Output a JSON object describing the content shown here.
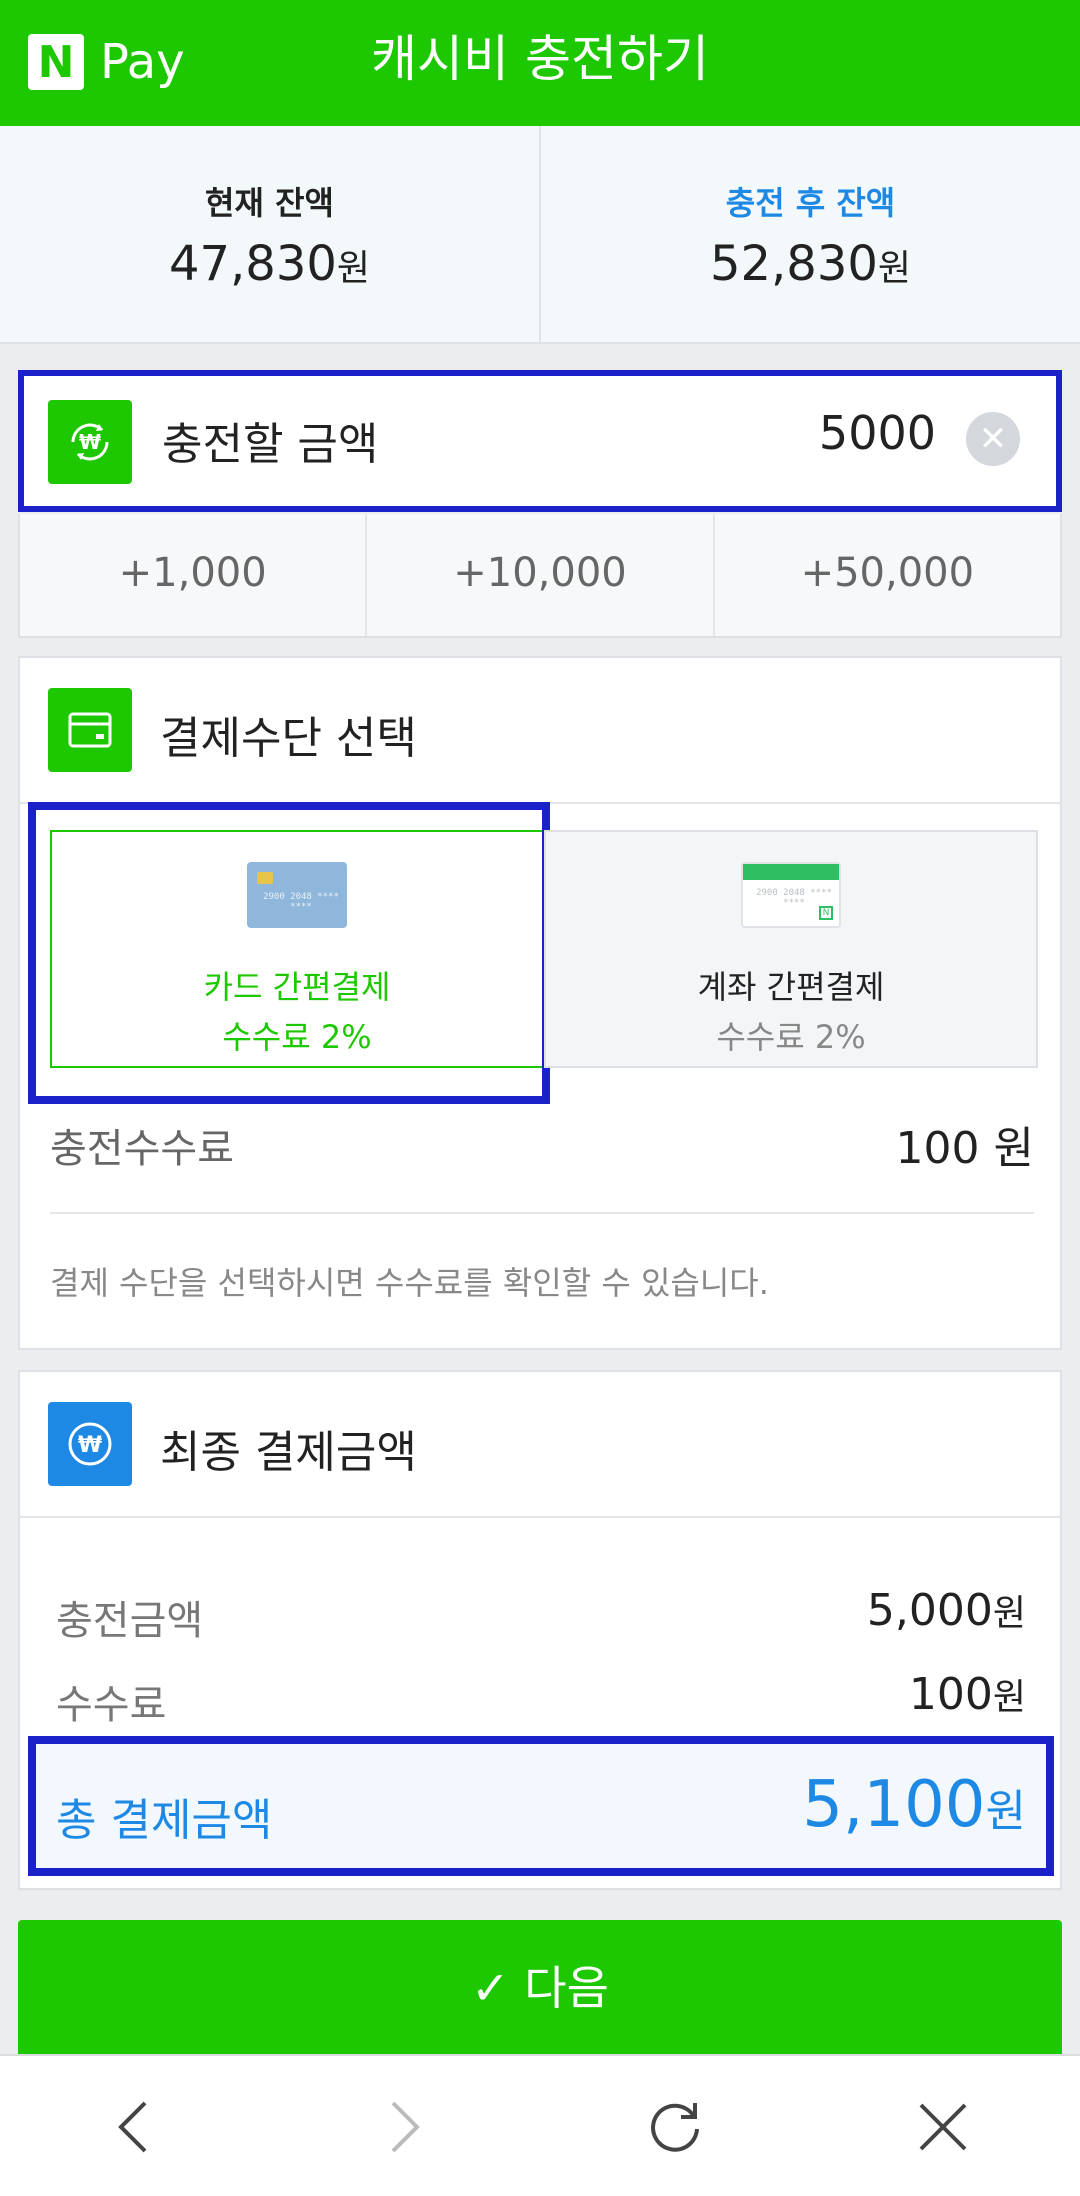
{
  "header": {
    "logo_n": "N",
    "logo_text": "Pay",
    "title": "캐시비 충전하기"
  },
  "balance": {
    "current_label": "현재 잔액",
    "current_value": "47,830",
    "after_label": "충전 후 잔액",
    "after_value": "52,830",
    "unit": "원"
  },
  "charge": {
    "label": "충전할 금액",
    "value": "5000",
    "quick_buttons": [
      "+1,000",
      "+10,000",
      "+50,000"
    ]
  },
  "payment": {
    "title": "결제수단 선택",
    "options": [
      {
        "name": "카드 간편결제",
        "fee": "수수료 2%",
        "selected": true,
        "card_number": "2900 2048 **** ****"
      },
      {
        "name": "계좌 간편결제",
        "fee": "수수료 2%",
        "selected": false,
        "card_number": "2900 2048 **** ****"
      }
    ],
    "fee_label": "충전수수료",
    "fee_value": "100  원",
    "note": "결제 수단을 선택하시면 수수료를 확인할 수 있습니다."
  },
  "final": {
    "title": "최종 결제금액",
    "charge_label": "충전금액",
    "charge_value": "5,000",
    "fee_label": "수수료",
    "fee_value": "100",
    "total_label": "총 결제금액",
    "total_value": "5,100",
    "unit": "원"
  },
  "next_button": {
    "label": "✓ 다음"
  },
  "colors": {
    "brand_green": "#1ec800",
    "accent_blue": "#1e88e5",
    "highlight": "#1b21c9"
  },
  "icons": [
    "won-refresh-icon",
    "card-icon",
    "won-icon",
    "back-icon",
    "forward-icon",
    "refresh-icon",
    "close-icon"
  ]
}
